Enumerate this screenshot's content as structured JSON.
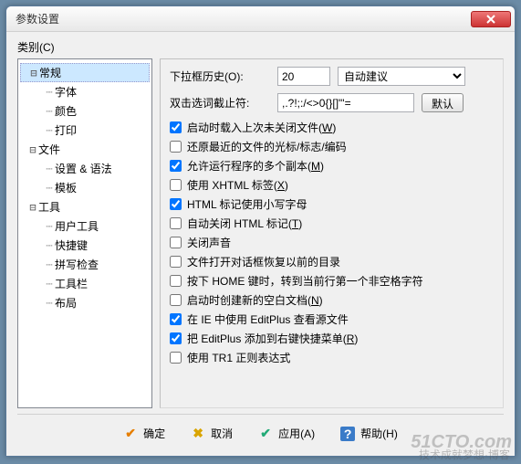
{
  "window": {
    "title": "参数设置"
  },
  "category_label": "类别(C)",
  "tree": [
    {
      "label": "常规",
      "depth": 1,
      "exp": "-",
      "sel": true
    },
    {
      "label": "字体",
      "depth": 2,
      "dash": true
    },
    {
      "label": "颜色",
      "depth": 2,
      "dash": true
    },
    {
      "label": "打印",
      "depth": 2,
      "dash": true
    },
    {
      "label": "文件",
      "depth": 1,
      "exp": "-"
    },
    {
      "label": "设置 & 语法",
      "depth": 2,
      "dash": true
    },
    {
      "label": "模板",
      "depth": 2,
      "dash": true
    },
    {
      "label": "工具",
      "depth": 1,
      "exp": "-"
    },
    {
      "label": "用户工具",
      "depth": 2,
      "dash": true
    },
    {
      "label": "快捷键",
      "depth": 2,
      "dash": true
    },
    {
      "label": "拼写检查",
      "depth": 2,
      "dash": true
    },
    {
      "label": "工具栏",
      "depth": 2,
      "dash": true
    },
    {
      "label": "布局",
      "depth": 2,
      "dash": true
    }
  ],
  "form": {
    "history_label": "下拉框历史(O):",
    "history_value": "20",
    "suggest_value": "自动建议",
    "dblclick_label": "双击选词截止符:",
    "dblclick_value": ",.?!;:/<>0{}[]\"'=",
    "default_btn": "默认"
  },
  "checks": [
    {
      "label": "启动时载入上次未关闭文件(W)",
      "checked": true,
      "u": "W"
    },
    {
      "label": "还原最近的文件的光标/标志/编码",
      "checked": false
    },
    {
      "label": "允许运行程序的多个副本(M)",
      "checked": true,
      "u": "M"
    },
    {
      "label": "使用 XHTML 标签(X)",
      "checked": false,
      "u": "X"
    },
    {
      "label": "HTML 标记使用小写字母",
      "checked": true
    },
    {
      "label": "自动关闭 HTML 标记(T)",
      "checked": false,
      "u": "T"
    },
    {
      "label": "关闭声音",
      "checked": false
    },
    {
      "label": "文件打开对话框恢复以前的目录",
      "checked": false
    },
    {
      "label": "按下 HOME 键时，转到当前行第一个非空格字符",
      "checked": false
    },
    {
      "label": "启动时创建新的空白文档(N)",
      "checked": false,
      "u": "N"
    },
    {
      "label": "在 IE 中使用 EditPlus 查看源文件",
      "checked": true
    },
    {
      "label": "把 EditPlus 添加到右键快捷菜单(R)",
      "checked": true,
      "u": "R"
    },
    {
      "label": "使用 TR1 正则表达式",
      "checked": false
    }
  ],
  "footer": {
    "ok": "确定",
    "cancel": "取消",
    "apply": "应用(A)",
    "help": "帮助(H)"
  },
  "watermark": "51CTO.com",
  "watermark2": "技术成就梦想·博客"
}
